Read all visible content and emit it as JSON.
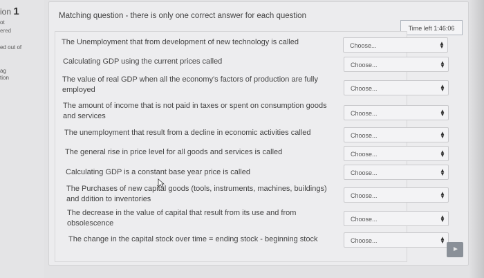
{
  "info": {
    "question_prefix": "ion",
    "question_number": "1",
    "line1": "ot",
    "line2": "ered",
    "line3": "ed out of",
    "line4": "ag",
    "line5": "tion"
  },
  "prompt": "Matching question - there is only one correct answer for each question",
  "timer": "Time left 1:46:06",
  "select_placeholder": "Choose...",
  "questions": [
    {
      "text": "The Unemployment that from development of new technology is called",
      "selected": "Choose..."
    },
    {
      "text": "Calculating GDP using the current prices called",
      "selected": "Choose..."
    },
    {
      "text": "The value of real GDP when all the economy's factors of production are fully employed",
      "selected": "Choose..."
    },
    {
      "text": "The amount of income that is not paid in taxes or spent on consumption goods and services",
      "selected": "Choose..."
    },
    {
      "text": "The unemployment that result from a decline in economic activities called",
      "selected": "Choose..."
    },
    {
      "text": "The general rise in price level for all goods and services is called",
      "selected": "Choose..."
    },
    {
      "text": "Calculating GDP is a constant base year price is called",
      "selected": "Choose..."
    },
    {
      "text": "The Purchases of new capital goods (tools, instruments, machines, buildings) and ddition to inventories",
      "selected": "Choose..."
    },
    {
      "text": "The decrease in the value of capital that result from its use and from obsolescence",
      "selected": "Choose..."
    },
    {
      "text": "The change in the capital stock over time = ending stock - beginning stock",
      "selected": "Choose..."
    }
  ]
}
